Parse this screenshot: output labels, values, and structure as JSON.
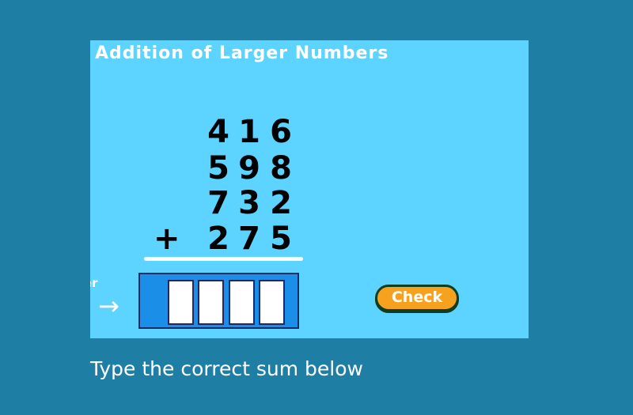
{
  "game": {
    "title": "Addition of Larger Numbers",
    "addends": [
      {
        "operator": "",
        "digits": [
          "4",
          "1",
          "6"
        ]
      },
      {
        "operator": "",
        "digits": [
          "5",
          "9",
          "8"
        ]
      },
      {
        "operator": "",
        "digits": [
          "7",
          "3",
          "2"
        ]
      },
      {
        "operator": "+",
        "digits": [
          "2",
          "7",
          "5"
        ]
      }
    ],
    "cut_label": "er",
    "arrow_icon": "→",
    "answer_cells": [
      "",
      "",
      "",
      ""
    ],
    "check_label": "Check"
  },
  "instruction": "Type the correct sum below",
  "colors": {
    "page_background": "#1f7ea3",
    "panel_background": "#5dd3ff",
    "answer_box": "#1b8fe8",
    "check_button": "#f7a21f"
  }
}
